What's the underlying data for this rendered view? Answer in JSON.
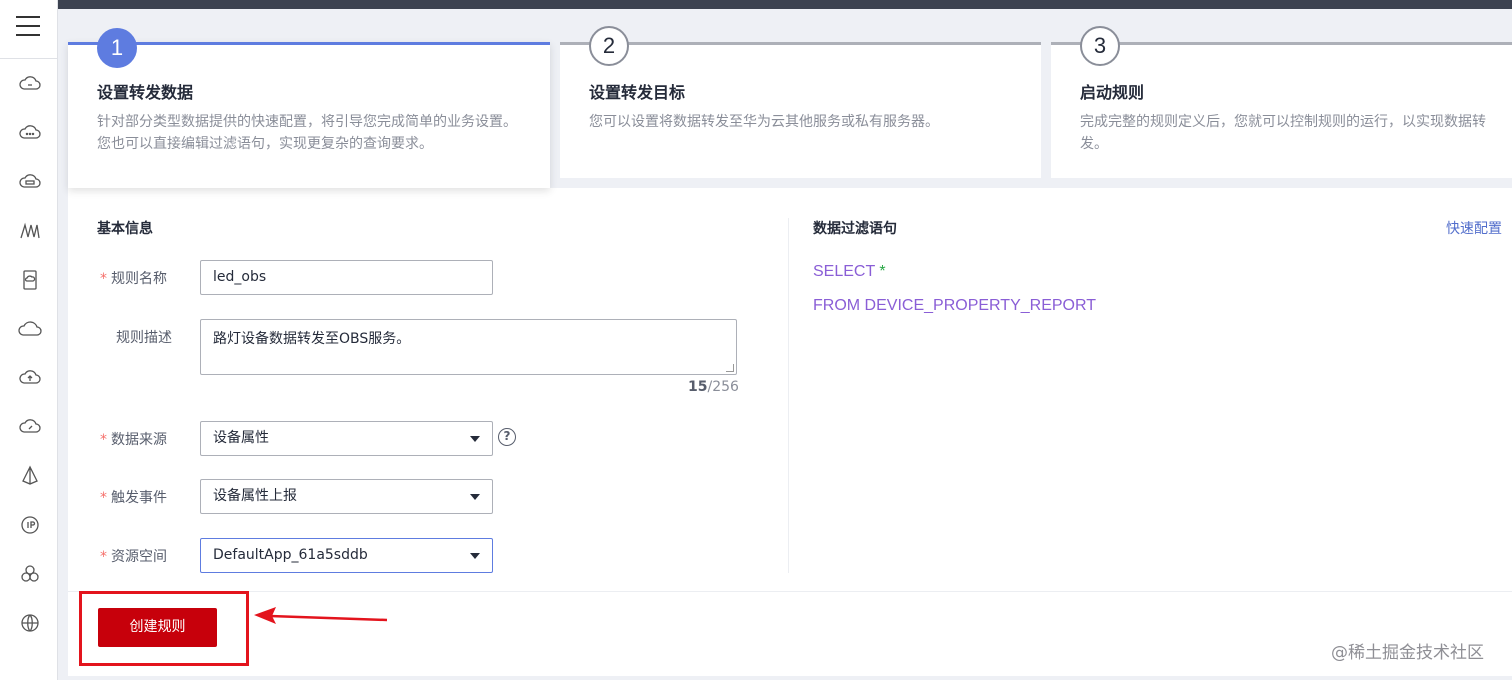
{
  "steps": [
    {
      "num": "1",
      "title": "设置转发数据",
      "desc": "针对部分类型数据提供的快速配置，将引导您完成简单的业务设置。您也可以直接编辑过滤语句，实现更复杂的查询要求。"
    },
    {
      "num": "2",
      "title": "设置转发目标",
      "desc": "您可以设置将数据转发至华为云其他服务或私有服务器。"
    },
    {
      "num": "3",
      "title": "启动规则",
      "desc": "完成完整的规则定义后，您就可以控制规则的运行，以实现数据转发。"
    }
  ],
  "basic": {
    "title": "基本信息",
    "required_mark": "*",
    "rule_name_label": "规则名称",
    "rule_name_value": "led_obs",
    "rule_desc_label": "规则描述",
    "rule_desc_value": "路灯设备数据转发至OBS服务。",
    "counter_current": "15",
    "counter_max": "/256",
    "data_source_label": "数据来源",
    "data_source_value": "设备属性",
    "trigger_label": "触发事件",
    "trigger_value": "设备属性上报",
    "resource_label": "资源空间",
    "resource_value": "DefaultApp_61a5sddb",
    "help_symbol": "?"
  },
  "filter": {
    "title": "数据过滤语句",
    "quick_config": "快速配置",
    "line1": "SELECT ",
    "line1_star": "*",
    "line2": "FROM DEVICE_PROPERTY_REPORT"
  },
  "actions": {
    "create_label": "创建规则"
  },
  "watermark": "@稀土掘金技术社区",
  "colors": {
    "primary": "#5e7ce0",
    "danger": "#c7000b",
    "annotation": "#e3141d",
    "sql": "#8a5ed6"
  }
}
